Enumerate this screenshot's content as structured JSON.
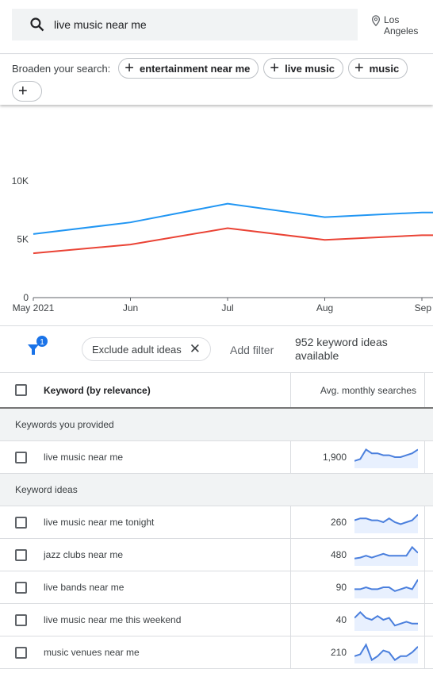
{
  "search": {
    "query": "live music near me",
    "location": "Los Angeles"
  },
  "broaden": {
    "label": "Broaden your search:",
    "chips": [
      "entertainment near me",
      "live music",
      "music",
      ""
    ]
  },
  "chart_data": {
    "type": "line",
    "categories": [
      "May 2021",
      "Jun",
      "Jul",
      "Aug",
      "Sep"
    ],
    "yticks": [
      "0",
      "5K",
      "10K"
    ],
    "ylim": [
      0,
      10000
    ],
    "series": [
      {
        "color": "#2196f3",
        "values": [
          5450,
          6450,
          8050,
          6900,
          7300
        ]
      },
      {
        "color": "#ea4335",
        "values": [
          3800,
          4550,
          5950,
          4950,
          5350
        ]
      }
    ]
  },
  "filters": {
    "badge": "1",
    "chip": "Exclude adult ideas",
    "add": "Add filter",
    "count": "952 keyword ideas available"
  },
  "table": {
    "headers": {
      "keyword": "Keyword (by relevance)",
      "searches": "Avg. monthly searches"
    },
    "groups": [
      {
        "label": "Keywords you provided",
        "rows": [
          {
            "keyword": "live music near me",
            "searches": "1,900",
            "trend": [
              3,
              4,
              9,
              7,
              7,
              6,
              6,
              5,
              5,
              6,
              7,
              9
            ]
          }
        ]
      },
      {
        "label": "Keyword ideas",
        "rows": [
          {
            "keyword": "live music near me tonight",
            "searches": "260",
            "trend": [
              6,
              7,
              7,
              6,
              6,
              5,
              7,
              5,
              4,
              5,
              6,
              9
            ]
          },
          {
            "keyword": "jazz clubs near me",
            "searches": "480",
            "trend": [
              3,
              3.5,
              4.5,
              3.5,
              4.5,
              5.5,
              4.5,
              4.5,
              4.5,
              4.5,
              9,
              6
            ]
          },
          {
            "keyword": "live bands near me",
            "searches": "90",
            "trend": [
              4,
              4,
              5,
              4,
              4,
              5,
              5,
              3,
              4,
              5,
              4,
              9
            ]
          },
          {
            "keyword": "live music near me this weekend",
            "searches": "40",
            "trend": [
              6,
              9,
              6,
              5,
              7,
              5,
              6,
              2,
              3,
              4,
              3,
              3
            ]
          },
          {
            "keyword": "music venues near me",
            "searches": "210",
            "trend": [
              3,
              4,
              9,
              1,
              3,
              6,
              5,
              1,
              3,
              3,
              5,
              8
            ]
          }
        ]
      }
    ]
  },
  "colors": {
    "accent": "#1a73e8",
    "sparkline": "#4a7fdd",
    "sparkfill": "#e8f0fe"
  }
}
